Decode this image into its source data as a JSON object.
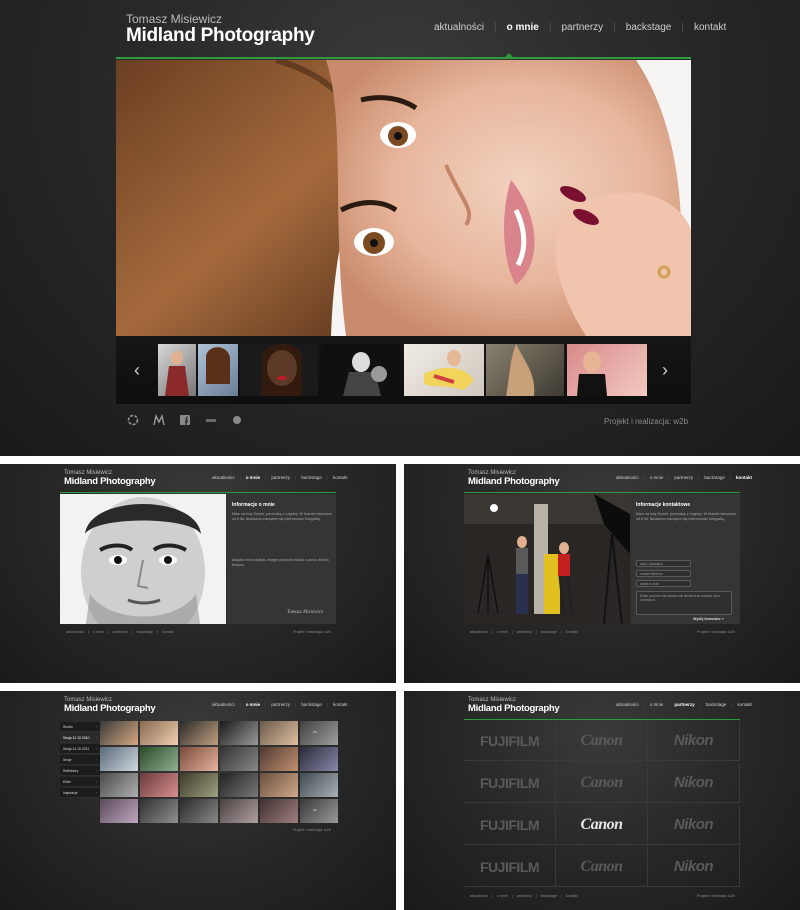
{
  "brand": {
    "name": "Tomasz Misiewicz",
    "title": "Midland Photography"
  },
  "nav": {
    "items": [
      "aktualności",
      "o mnie",
      "partnerzy",
      "backstage",
      "kontakt"
    ],
    "active_main": 1
  },
  "footer": {
    "credit": "Projekt i realizacja: w2b",
    "nav": [
      "aktualności",
      "o mnie",
      "partnerzy",
      "backstage",
      "kontakt"
    ],
    "seps": [
      "|",
      "|",
      "|",
      "|"
    ]
  },
  "social": [
    "circle-icon",
    "m-icon",
    "facebook-icon",
    "rss-icon",
    "globe-icon"
  ],
  "about": {
    "heading": "Informacje o mnie",
    "paragraph1": "Mam na imię Tomek, pochodzę z Legnicy. W Irlandii mieszkam od 8 lat. Niedawno zacząłem się interesować fotografią, ",
    "paragraph2": "aliquam erat volutpat. Integer placerat mauris a purus dictum tempus. ",
    "signature": "Tomasz Misiewicz"
  },
  "contact": {
    "heading": "Informacje kontaktowe",
    "field_name": "imię i nazwisko",
    "field_phone": "numer telefonu",
    "field_email": "adres e-mail",
    "message": "Etiam posuere nisl facilisis nisl tincidunt eu sodales dolor consequat.",
    "submit": "Wyślij formularz »"
  },
  "gallery": {
    "sidebar": [
      "Studio",
      "Sesja 12.10.2010",
      "Sesja 14.10.2011",
      "Sesje",
      "Reflektory",
      "Ekler",
      "Inspiracje"
    ]
  },
  "partners": {
    "brands": [
      "FUJIFILM",
      "Canon",
      "Nikon"
    ]
  }
}
